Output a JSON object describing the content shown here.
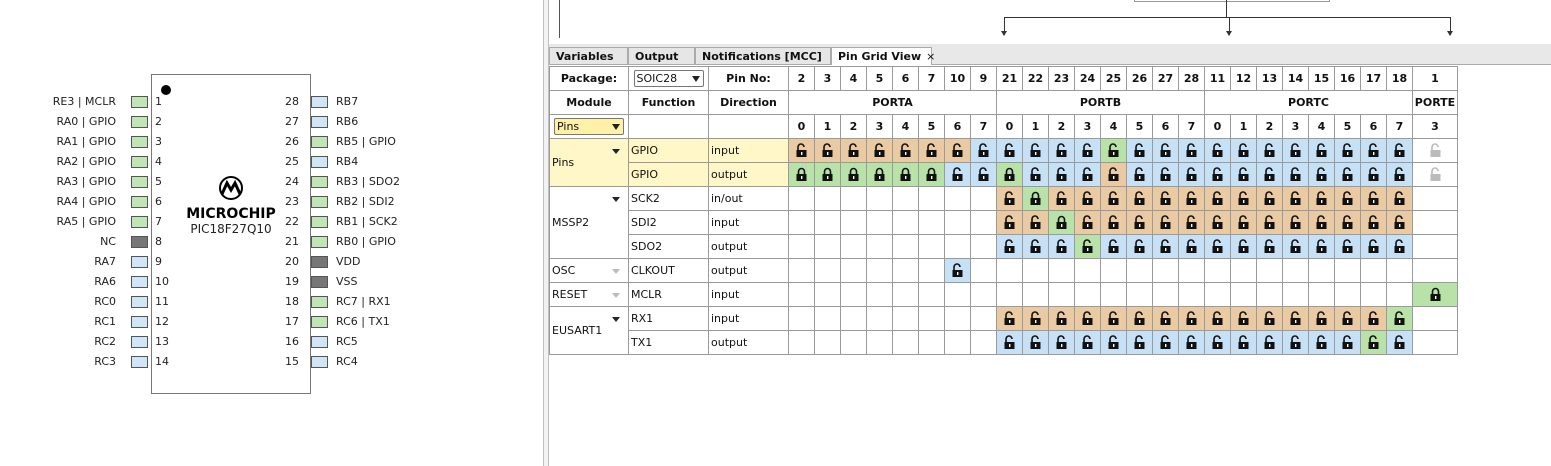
{
  "chip": {
    "brand": "MICROCHIP",
    "part": "PIC18F27Q10",
    "left_pins": [
      {
        "num": "1",
        "label": "RE3 | MCLR",
        "color": "green"
      },
      {
        "num": "2",
        "label": "RA0 | GPIO",
        "color": "green"
      },
      {
        "num": "3",
        "label": "RA1 | GPIO",
        "color": "green"
      },
      {
        "num": "4",
        "label": "RA2 | GPIO",
        "color": "green"
      },
      {
        "num": "5",
        "label": "RA3 | GPIO",
        "color": "green"
      },
      {
        "num": "6",
        "label": "RA4 | GPIO",
        "color": "green"
      },
      {
        "num": "7",
        "label": "RA5 | GPIO",
        "color": "green"
      },
      {
        "num": "8",
        "label": "NC",
        "color": "gray"
      },
      {
        "num": "9",
        "label": "RA7",
        "color": "blue"
      },
      {
        "num": "10",
        "label": "RA6",
        "color": "blue"
      },
      {
        "num": "11",
        "label": "RC0",
        "color": "blue"
      },
      {
        "num": "12",
        "label": "RC1",
        "color": "blue"
      },
      {
        "num": "13",
        "label": "RC2",
        "color": "blue"
      },
      {
        "num": "14",
        "label": "RC3",
        "color": "blue"
      }
    ],
    "right_pins": [
      {
        "num": "28",
        "label": "RB7",
        "color": "blue"
      },
      {
        "num": "27",
        "label": "RB6",
        "color": "blue"
      },
      {
        "num": "26",
        "label": "RB5 | GPIO",
        "color": "green"
      },
      {
        "num": "25",
        "label": "RB4",
        "color": "blue"
      },
      {
        "num": "24",
        "label": "RB3 | SDO2",
        "color": "green"
      },
      {
        "num": "23",
        "label": "RB2 | SDI2",
        "color": "green"
      },
      {
        "num": "22",
        "label": "RB1 | SCK2",
        "color": "green"
      },
      {
        "num": "21",
        "label": "RB0 | GPIO",
        "color": "green"
      },
      {
        "num": "20",
        "label": "VDD",
        "color": "gray"
      },
      {
        "num": "19",
        "label": "VSS",
        "color": "gray"
      },
      {
        "num": "18",
        "label": "RC7 | RX1",
        "color": "green"
      },
      {
        "num": "17",
        "label": "RC6 | TX1",
        "color": "green"
      },
      {
        "num": "16",
        "label": "RC5",
        "color": "blue"
      },
      {
        "num": "15",
        "label": "RC4",
        "color": "blue"
      }
    ]
  },
  "tabs": [
    {
      "label": "Variables",
      "active": false
    },
    {
      "label": "Output",
      "active": false
    },
    {
      "label": "Notifications [MCC]",
      "active": false
    },
    {
      "label": "Pin Grid View",
      "active": true
    }
  ],
  "tab_close": "×",
  "grid": {
    "package_label": "Package:",
    "package_value": "SOIC28",
    "pinno_label": "Pin No:",
    "pin_numbers": [
      "2",
      "3",
      "4",
      "5",
      "6",
      "7",
      "10",
      "9",
      "21",
      "22",
      "23",
      "24",
      "25",
      "26",
      "27",
      "28",
      "11",
      "12",
      "13",
      "14",
      "15",
      "16",
      "17",
      "18",
      "1"
    ],
    "module_label": "Module",
    "function_label": "Function",
    "direction_label": "Direction",
    "ports": [
      {
        "name": "PORTA",
        "span": 8
      },
      {
        "name": "PORTB",
        "span": 8
      },
      {
        "name": "PORTC",
        "span": 8
      },
      {
        "name": "PORTE",
        "span": 1
      }
    ],
    "bits": [
      "0",
      "1",
      "2",
      "3",
      "4",
      "5",
      "6",
      "7",
      "0",
      "1",
      "2",
      "3",
      "4",
      "5",
      "6",
      "7",
      "0",
      "1",
      "2",
      "3",
      "4",
      "5",
      "6",
      "7",
      "3"
    ],
    "module_filter": "Pins",
    "groups": [
      {
        "module": "Pins",
        "highlight": true,
        "caret": "dark",
        "rows": [
          {
            "function": "GPIO",
            "direction": "input",
            "cells": "ooooooobbbbbgbbbbbbbbbbbd"
          },
          {
            "function": "GPIO",
            "direction": "output",
            "cells": "GGGGGGbbGbbbobbbbbbbbbbbd"
          }
        ]
      },
      {
        "module": "MSSP2",
        "highlight": false,
        "caret": "dark",
        "rows": [
          {
            "function": "SCK2",
            "direction": "in/out",
            "cells": "........oGoooooooooooooo."
          },
          {
            "function": "SDI2",
            "direction": "input",
            "cells": "........ooGooooooooooooo."
          },
          {
            "function": "SDO2",
            "direction": "output",
            "cells": "........bbbgbbbbbbbbbbbb."
          }
        ]
      },
      {
        "module": "OSC",
        "highlight": false,
        "caret": "light",
        "rows": [
          {
            "function": "CLKOUT",
            "direction": "output",
            "cells": "......b.................."
          }
        ]
      },
      {
        "module": "RESET",
        "highlight": false,
        "caret": "light",
        "rows": [
          {
            "function": "MCLR",
            "direction": "input",
            "cells": "........................G"
          }
        ]
      },
      {
        "module": "EUSART1",
        "highlight": false,
        "caret": "dark",
        "rows": [
          {
            "function": "RX1",
            "direction": "input",
            "cells": "........ooooooooooooooog."
          },
          {
            "function": "TX1",
            "direction": "output",
            "cells": "........bbbbbbbbbbbbbbgb."
          }
        ]
      }
    ]
  },
  "colors": {
    "pin_green": "#bfe6b4",
    "pin_blue": "#cfe6f7",
    "pin_gray": "#777777",
    "cell_blue": "#c6e0f5",
    "cell_orange": "#e9caa2",
    "cell_green": "#b9e2a9",
    "pins_row_highlight": "#fff7c8"
  },
  "icons": {
    "unlocked": "padlock-open-icon",
    "locked": "padlock-closed-icon",
    "disabled": "padlock-disabled-icon"
  }
}
